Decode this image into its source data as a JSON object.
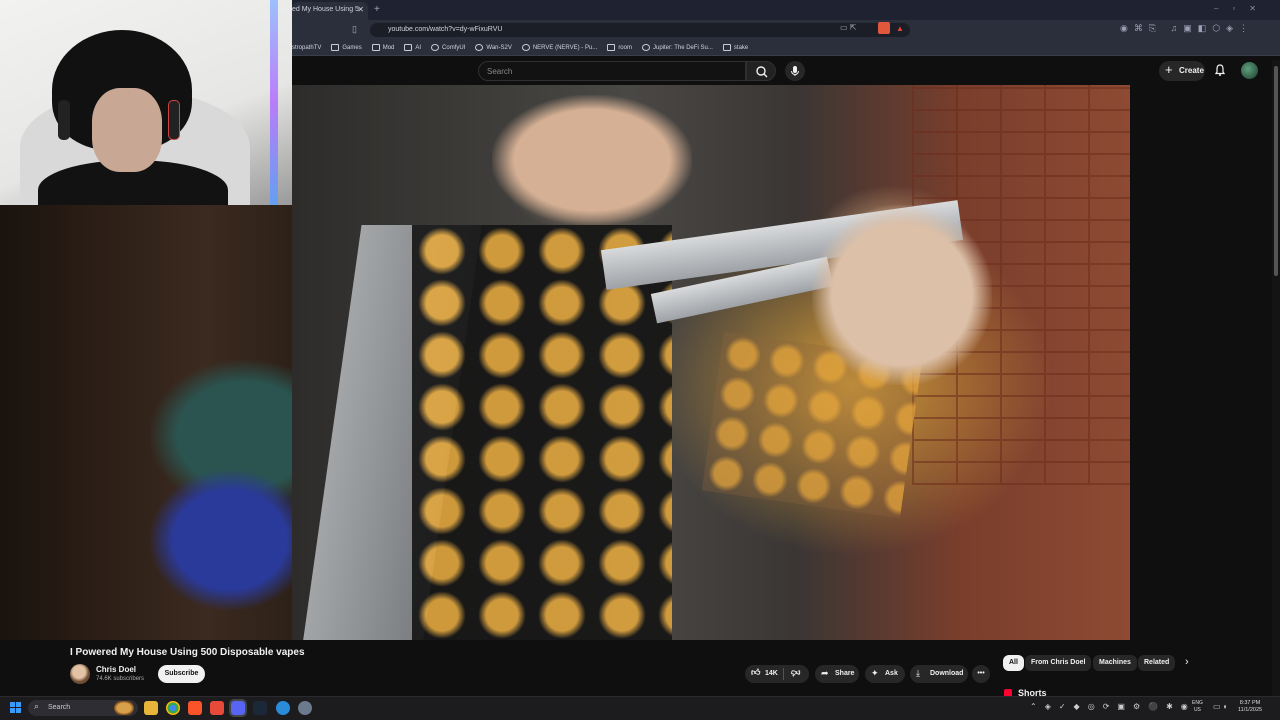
{
  "browser": {
    "tab_title": "ed My House Using 5",
    "url": "youtube.com/watch?v=dy-wFixuRVU",
    "bookmarks": [
      "stropathTV",
      "Games",
      "Mod",
      "AI",
      "ComfyUI",
      "Wan-S2V",
      "NERVE (NERVE) - Pu...",
      "room",
      "Jupiter: The DeFi Su...",
      "stake"
    ]
  },
  "youtube": {
    "search_placeholder": "Search",
    "create_label": "Create",
    "video_title": "I Powered My House Using 500 Disposable vapes",
    "channel_name": "Chris Doel",
    "subscribers": "74.6K subscribers",
    "subscribe_label": "Subscribe",
    "likes": "14K",
    "share_label": "Share",
    "ask_label": "Ask",
    "download_label": "Download",
    "chips": [
      "All",
      "From Chris Doel",
      "Machines",
      "Related"
    ],
    "shorts_label": "Shorts"
  },
  "taskbar": {
    "search_placeholder": "Search",
    "lang_top": "ENG",
    "lang_bottom": "US",
    "time": "8:37 PM",
    "date": "11/1/2025"
  },
  "colors": {
    "youtube_bg": "#0f0f0f",
    "pill_bg": "#272727",
    "accent_red": "#ff0033",
    "browser_chrome": "#2b2e3b"
  }
}
